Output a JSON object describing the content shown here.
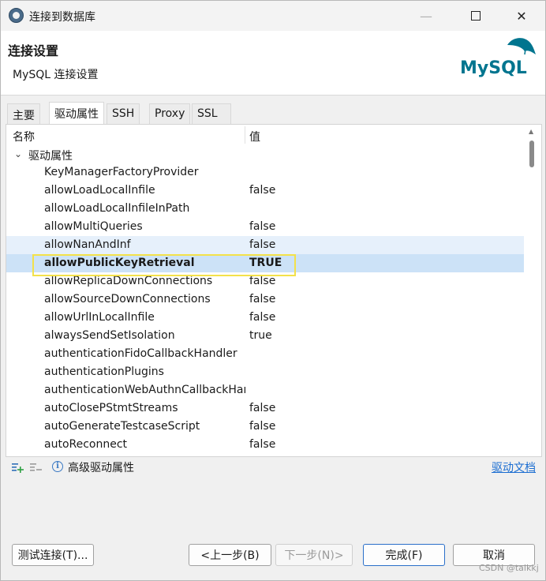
{
  "window": {
    "title": "连接到数据库",
    "min_glyph": "—",
    "close_glyph": "✕"
  },
  "header": {
    "title": "连接设置",
    "subtitle": "MySQL 连接设置",
    "logo_text": "MySQL",
    "logo_color": "#00758f",
    "logo_accent": "#f29111"
  },
  "tabs": [
    {
      "label": "主要"
    },
    {
      "label": "驱动属性"
    },
    {
      "label": "SSH"
    },
    {
      "label": "Proxy"
    },
    {
      "label": "SSL"
    }
  ],
  "table": {
    "columns": {
      "name": "名称",
      "value": "值"
    },
    "group_label": "驱动属性",
    "rows": [
      {
        "name": "KeyManagerFactoryProvider",
        "value": ""
      },
      {
        "name": "allowLoadLocalInfile",
        "value": "false"
      },
      {
        "name": "allowLoadLocalInfileInPath",
        "value": ""
      },
      {
        "name": "allowMultiQueries",
        "value": "false"
      },
      {
        "name": "allowNanAndInf",
        "value": "false"
      },
      {
        "name": "allowPublicKeyRetrieval",
        "value": "TRUE"
      },
      {
        "name": "allowReplicaDownConnections",
        "value": "false"
      },
      {
        "name": "allowSourceDownConnections",
        "value": "false"
      },
      {
        "name": "allowUrlInLocalInfile",
        "value": "false"
      },
      {
        "name": "alwaysSendSetIsolation",
        "value": "true"
      },
      {
        "name": "authenticationFidoCallbackHandler",
        "value": ""
      },
      {
        "name": "authenticationPlugins",
        "value": ""
      },
      {
        "name": "authenticationWebAuthnCallbackHandler",
        "value": ""
      },
      {
        "name": "autoClosePStmtStreams",
        "value": "false"
      },
      {
        "name": "autoGenerateTestcaseScript",
        "value": "false"
      },
      {
        "name": "autoReconnect",
        "value": "false"
      }
    ]
  },
  "toolbar": {
    "advanced_label": "高级驱动属性",
    "doc_link": "驱动文档"
  },
  "buttons": {
    "test": "测试连接(T)...",
    "back": "<上一步(B)",
    "next": "下一步(N)>",
    "finish": "完成(F)",
    "cancel": "取消"
  },
  "watermark": "CSDN @talkkj"
}
